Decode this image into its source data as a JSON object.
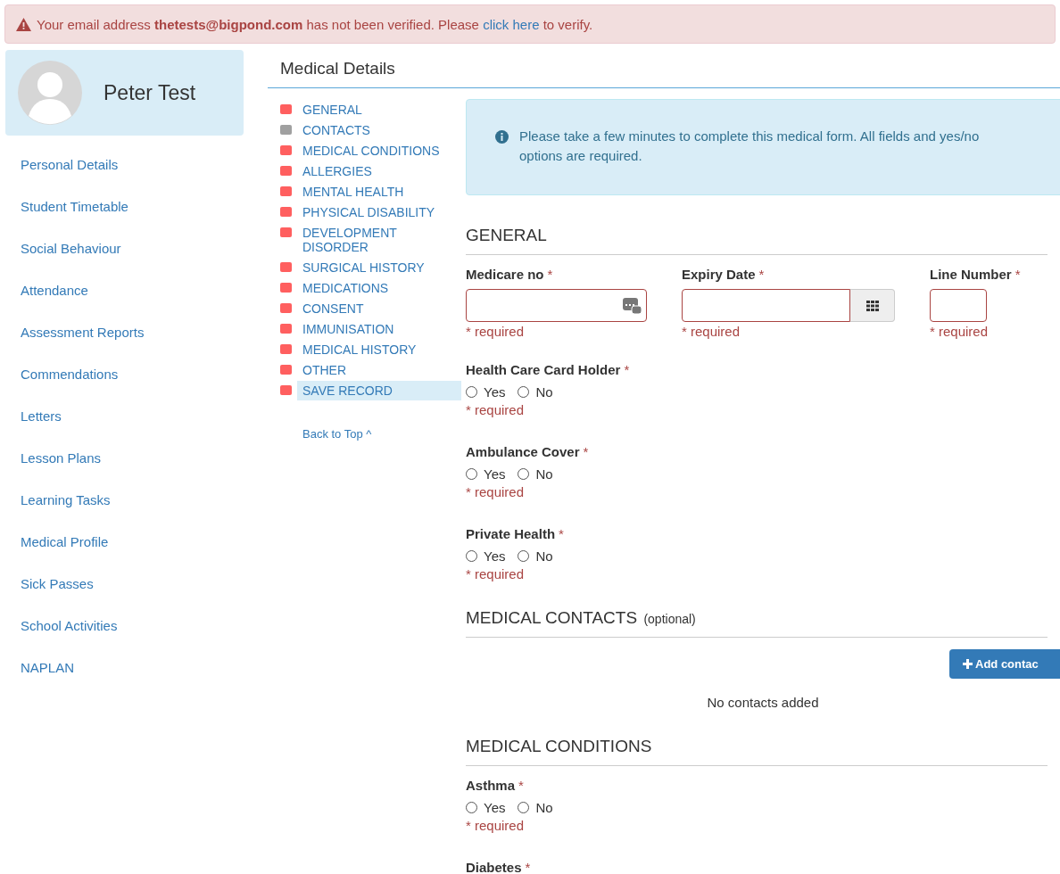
{
  "alert": {
    "before": "Your email address **thetests@bigpond.com** has not been verified. Please",
    "link": "click here",
    "after": "to verify."
  },
  "profile": {
    "name": "Peter Test"
  },
  "sidebar": {
    "items": [
      {
        "label": "Personal Details"
      },
      {
        "label": "Student Timetable"
      },
      {
        "label": "Social Behaviour"
      },
      {
        "label": "Attendance"
      },
      {
        "label": "Assessment Reports"
      },
      {
        "label": "Commendations"
      },
      {
        "label": "Letters"
      },
      {
        "label": "Lesson Plans"
      },
      {
        "label": "Learning Tasks"
      },
      {
        "label": "Medical Profile"
      },
      {
        "label": "Sick Passes"
      },
      {
        "label": "School Activities"
      },
      {
        "label": "NAPLAN"
      }
    ]
  },
  "page_title": "Medical Details",
  "index": {
    "items": [
      {
        "label": "GENERAL",
        "color": "#ff5f5f",
        "selected": false
      },
      {
        "label": "CONTACTS",
        "color": "#a0a0a0",
        "selected": false
      },
      {
        "label": "MEDICAL CONDITIONS",
        "color": "#ff5f5f",
        "selected": false
      },
      {
        "label": "ALLERGIES",
        "color": "#ff5f5f",
        "selected": false
      },
      {
        "label": "MENTAL HEALTH",
        "color": "#ff5f5f",
        "selected": false
      },
      {
        "label": "PHYSICAL DISABILITY",
        "color": "#ff5f5f",
        "selected": false
      },
      {
        "label": "DEVELOPMENT DISORDER",
        "color": "#ff5f5f",
        "selected": false
      },
      {
        "label": "SURGICAL HISTORY",
        "color": "#ff5f5f",
        "selected": false
      },
      {
        "label": "MEDICATIONS",
        "color": "#ff5f5f",
        "selected": false
      },
      {
        "label": "CONSENT",
        "color": "#ff5f5f",
        "selected": false
      },
      {
        "label": "IMMUNISATION",
        "color": "#ff5f5f",
        "selected": false
      },
      {
        "label": "MEDICAL HISTORY",
        "color": "#ff5f5f",
        "selected": false
      },
      {
        "label": "OTHER",
        "color": "#ff5f5f",
        "selected": false
      },
      {
        "label": "SAVE RECORD",
        "color": "#ff5f5f",
        "selected": true
      }
    ],
    "back_to_top": "Back to Top ^"
  },
  "info": "Please take a few minutes to complete this medical form. All fields and yes/no options are required.",
  "sections": [
    {
      "heading": "GENERAL",
      "items": [
        {
          "kind": "inputs",
          "fields": [
            {
              "kind": "number",
              "label": "Medicare no",
              "mark": "*",
              "error": "* required"
            },
            {
              "kind": "date",
              "label": "Expiry Date",
              "mark": "*",
              "error": "* required"
            },
            {
              "kind": "short",
              "label": "Line Number",
              "mark": "*",
              "error": "* required"
            }
          ]
        },
        {
          "kind": "radio",
          "label": "Health Care Card Holder",
          "mark": "*",
          "options": [
            {
              "label": "Yes",
              "selected": false
            },
            {
              "label": "No",
              "selected": false
            }
          ],
          "error": "* required"
        },
        {
          "kind": "radio",
          "label": "Ambulance Cover",
          "mark": "*",
          "options": [
            {
              "label": "Yes",
              "selected": false
            },
            {
              "label": "No",
              "selected": false
            }
          ],
          "error": "* required"
        },
        {
          "kind": "radio",
          "label": "Private Health",
          "mark": "*",
          "options": [
            {
              "label": "Yes",
              "selected": false
            },
            {
              "label": "No",
              "selected": false
            }
          ],
          "error": "* required"
        }
      ]
    },
    {
      "heading": "MEDICAL CONTACTS",
      "note": "(optional)",
      "items": [
        {
          "kind": "contacts",
          "button": "Add contac",
          "empty": "No contacts added"
        }
      ]
    },
    {
      "heading": "MEDICAL CONDITIONS",
      "items": [
        {
          "kind": "radio",
          "label": "Asthma",
          "mark": "*",
          "options": [
            {
              "label": "Yes",
              "selected": false
            },
            {
              "label": "No",
              "selected": false
            }
          ],
          "error": "* required"
        },
        {
          "kind": "label",
          "label": "Diabetes",
          "mark": "*"
        }
      ]
    }
  ]
}
